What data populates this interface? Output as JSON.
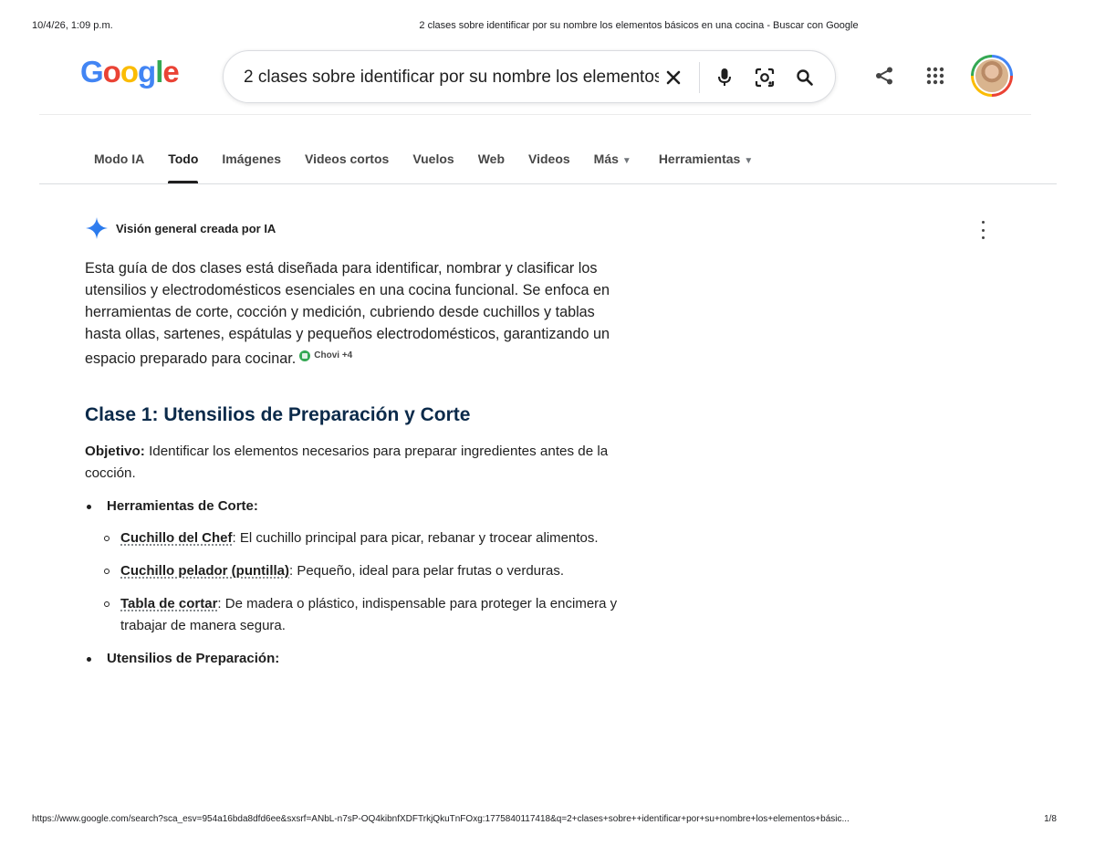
{
  "print_header": {
    "datetime": "10/4/26, 1:09 p.m.",
    "page_title": "2 clases sobre identificar por su nombre los elementos básicos en una cocina - Buscar con Google"
  },
  "logo": {
    "letters": [
      "G",
      "o",
      "o",
      "g",
      "l",
      "e"
    ],
    "colors": [
      "#4285F4",
      "#EA4335",
      "#FBBC05",
      "#4285F4",
      "#34A853",
      "#EA4335"
    ]
  },
  "search": {
    "query": "2 clases sobre identificar por su nombre los elementos básicos en una cocina",
    "icons": [
      "close-icon",
      "mic-icon",
      "lens-icon",
      "search-icon"
    ]
  },
  "header_icons": [
    "share-icon",
    "apps-grid-icon",
    "avatar"
  ],
  "tabs": [
    {
      "label": "Modo IA"
    },
    {
      "label": "Todo",
      "active": true
    },
    {
      "label": "Imágenes"
    },
    {
      "label": "Videos cortos"
    },
    {
      "label": "Vuelos"
    },
    {
      "label": "Web"
    },
    {
      "label": "Videos"
    },
    {
      "label": "Más",
      "dropdown": true
    },
    {
      "label": "Herramientas",
      "dropdown": true
    }
  ],
  "ai_overview": {
    "heading": "Visión general creada por IA",
    "summary": "Esta guía de dos clases está diseñada para identificar, nombrar y clasificar los utensilios y electrodomésticos esenciales en una cocina funcional. Se enfoca en herramientas de corte, cocción y medición, cubriendo desde cuchillos y tablas hasta ollas, sartenes, espátulas y pequeños electrodomésticos, garantizando un espacio preparado para cocinar.",
    "source_chip": "Chovi +4",
    "accent_color": "#4285F4"
  },
  "clase1": {
    "title": "Clase 1: Utensilios de Preparación y Corte",
    "objective_label": "Objetivo:",
    "objective_text": "Identificar los elementos necesarios para preparar ingredientes antes de la cocción.",
    "groups": [
      {
        "heading": "Herramientas de Corte:",
        "items": [
          {
            "term": "Cuchillo del Chef",
            "desc": ": El cuchillo principal para picar, rebanar y trocear alimentos."
          },
          {
            "term": "Cuchillo pelador (puntilla)",
            "desc": ": Pequeño, ideal para pelar frutas o verduras."
          },
          {
            "term": "Tabla de cortar",
            "desc": ": De madera o plástico, indispensable para proteger la encimera y trabajar de manera segura."
          }
        ]
      },
      {
        "heading": "Utensilios de Preparación:",
        "items": []
      }
    ]
  },
  "print_footer": {
    "url": "https://www.google.com/search?sca_esv=954a16bda8dfd6ee&sxsrf=ANbL-n7sP-OQ4kibnfXDFTrkjQkuTnFOxg:1775840117418&q=2+clases+sobre++identificar+por+su+nombre+los+elementos+básic...",
    "page": "1/8"
  }
}
